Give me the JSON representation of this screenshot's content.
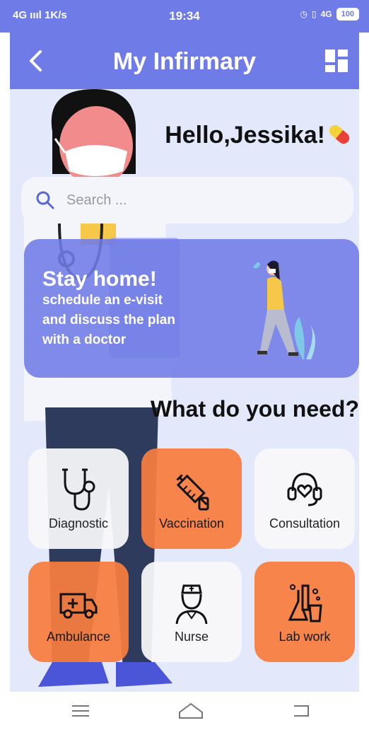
{
  "status": {
    "left": "4G ıııl 1K/s",
    "time": "19:34",
    "right": "4G",
    "battery": "100"
  },
  "app": {
    "title": "My Infirmary"
  },
  "greeting": "Hello,Jessika!",
  "search": {
    "placeholder": "Search ..."
  },
  "banner": {
    "title": "Stay home!",
    "lines": [
      "schedule an e-visit",
      "and discuss the plan",
      "with a doctor"
    ]
  },
  "section_title": "What do you need?",
  "services": [
    {
      "label": "Diagnostic"
    },
    {
      "label": "Vaccination"
    },
    {
      "label": "Consultation"
    },
    {
      "label": "Ambulance"
    },
    {
      "label": "Nurse"
    },
    {
      "label": "Lab work"
    }
  ],
  "colors": {
    "primary": "#6f7be6",
    "accent": "#f77d40",
    "background": "#e3e8fb"
  }
}
